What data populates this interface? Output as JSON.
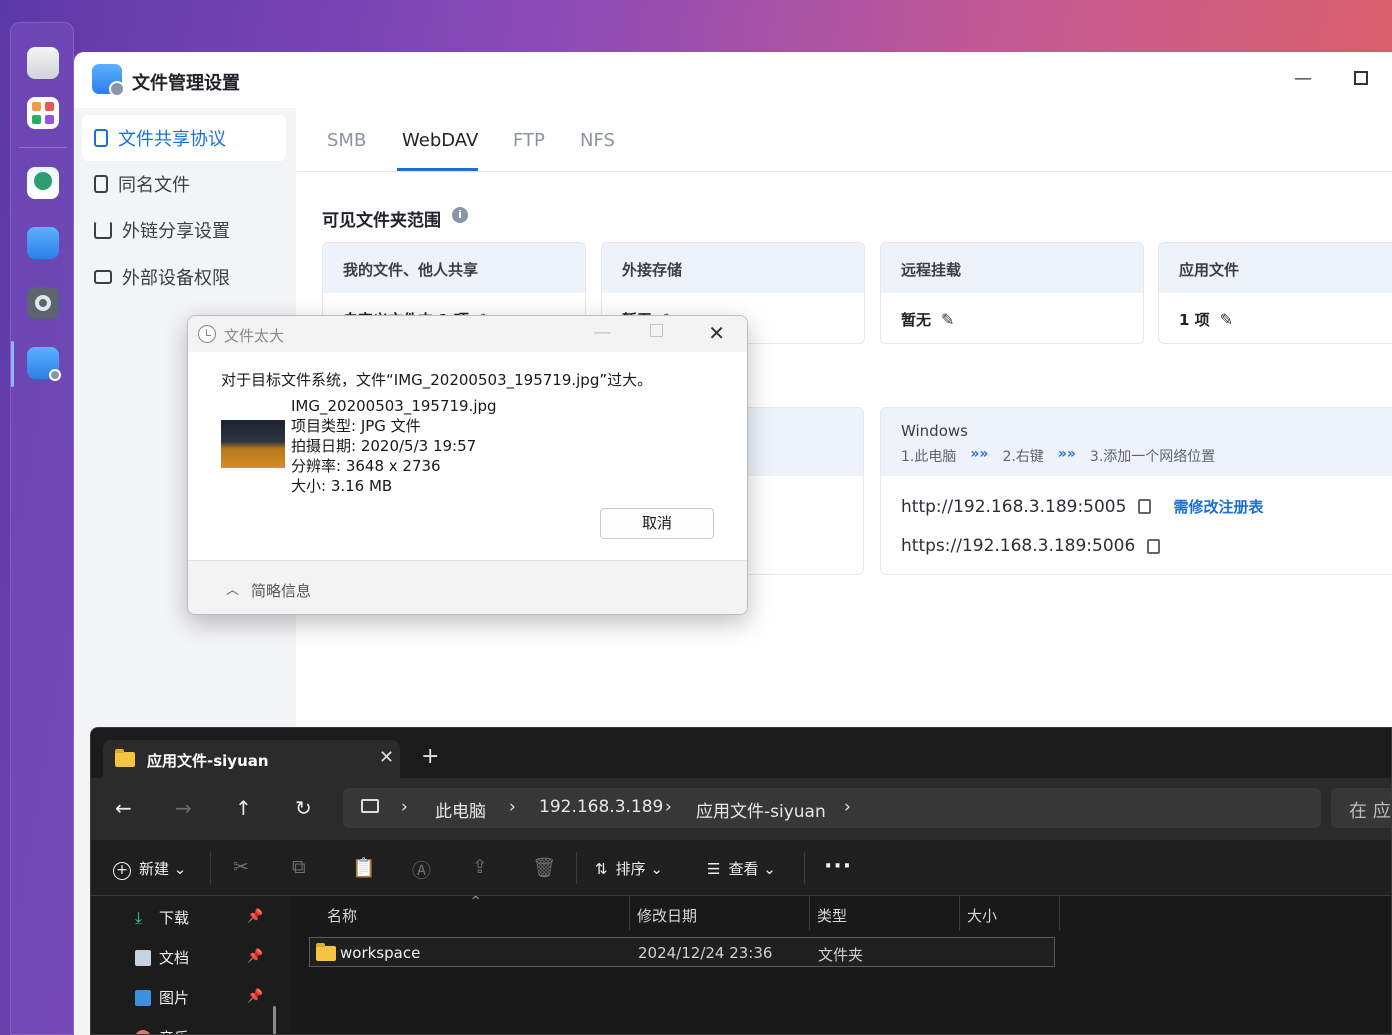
{
  "dock": {
    "icons": [
      "monitor-icon",
      "app-grid-icon",
      "earth-icon",
      "file-manager-icon",
      "settings-gear-icon",
      "file-settings-icon"
    ]
  },
  "fm": {
    "title": "文件管理设置",
    "sidebar": [
      {
        "label": "文件共享协议",
        "icon": "document-icon",
        "active": true
      },
      {
        "label": "同名文件",
        "icon": "file-icon",
        "active": false
      },
      {
        "label": "外链分享设置",
        "icon": "share-icon",
        "active": false
      },
      {
        "label": "外部设备权限",
        "icon": "drive-icon",
        "active": false
      }
    ],
    "tabs": [
      "SMB",
      "WebDAV",
      "FTP",
      "NFS"
    ],
    "active_tab": "WebDAV",
    "section_title": "可见文件夹范围",
    "cards": [
      {
        "title": "我的文件、他人共享",
        "value": "自定义文件夹 1 项"
      },
      {
        "title": "外接存储",
        "value": "暂无"
      },
      {
        "title": "远程挂载",
        "value": "暂无"
      },
      {
        "title": "应用文件",
        "value": "1 项"
      }
    ],
    "windows_card": {
      "title": "Windows",
      "steps": [
        "1.此电脑",
        "2.右键",
        "3.添加一个网络位置"
      ],
      "step_arrow": "»»",
      "http_url": "http://192.168.3.189:5005",
      "https_url": "https://192.168.3.189:5006",
      "registry_link": "需修改注册表"
    },
    "accent": "#1d6fd8"
  },
  "dialog": {
    "title": "文件太大",
    "message": "对于目标文件系统，文件“IMG_20200503_195719.jpg”过大。",
    "file_name": "IMG_20200503_195719.jpg",
    "item_type": "项目类型: JPG 文件",
    "date_taken": "拍摄日期: 2020/5/3 19:57",
    "resolution": "分辨率: 3648 x 2736",
    "size": "大小: 3.16 MB",
    "cancel": "取消",
    "less_info": "简略信息"
  },
  "explorer": {
    "tab_label": "应用文件-siyuan",
    "new_tab": "+",
    "breadcrumb": [
      "此电脑",
      "192.168.3.189",
      "应用文件-siyuan"
    ],
    "search_placeholder": "在 应",
    "toolbar": {
      "new": "新建",
      "sort": "排序",
      "view": "查看"
    },
    "nav_items": [
      {
        "label": "下载",
        "icon": "download-icon"
      },
      {
        "label": "文档",
        "icon": "documents-icon"
      },
      {
        "label": "图片",
        "icon": "pictures-icon"
      },
      {
        "label": "音乐",
        "icon": "music-icon"
      }
    ],
    "columns": [
      "名称",
      "修改日期",
      "类型",
      "大小"
    ],
    "rows": [
      {
        "name": "workspace",
        "modified": "2024/12/24 23:36",
        "type": "文件夹",
        "size": ""
      }
    ]
  }
}
